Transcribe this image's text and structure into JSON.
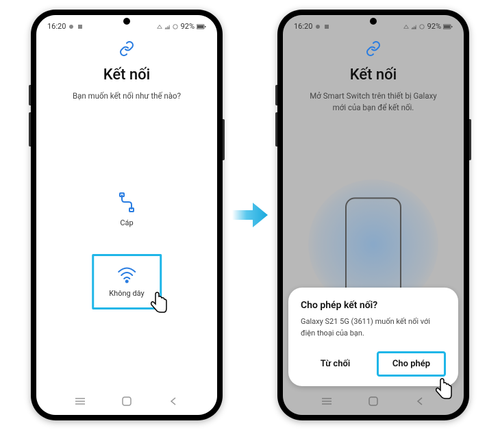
{
  "status": {
    "time": "16:20",
    "battery": "92%"
  },
  "screen1": {
    "title": "Kết nối",
    "subtitle": "Bạn muốn kết nối như thế nào?",
    "option_cable": "Cáp",
    "option_wireless": "Không dây"
  },
  "screen2": {
    "title": "Kết nối",
    "subtitle": "Mở Smart Switch trên thiết bị Galaxy mới của bạn để kết nối."
  },
  "dialog": {
    "title": "Cho phép kết nối?",
    "body": "Galaxy S21 5G (3611) muốn kết nối với điện thoại của bạn.",
    "deny": "Từ chối",
    "allow": "Cho phép"
  }
}
